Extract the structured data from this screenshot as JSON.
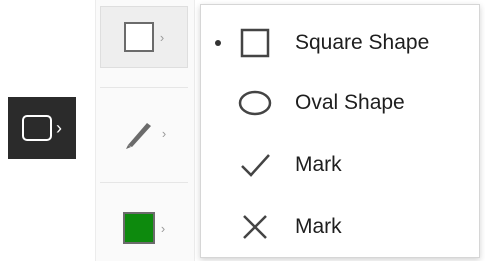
{
  "left_tool": {
    "icon": "rectangle-icon",
    "chevron": "›"
  },
  "toolbar": {
    "items": [
      {
        "name": "shape-tool-button",
        "icon": "square-icon",
        "chevron": "›",
        "selected": true
      },
      {
        "name": "pen-tool-button",
        "icon": "pen-icon",
        "chevron": "›",
        "selected": false
      },
      {
        "name": "color-tool-button",
        "icon": "color-swatch-icon",
        "chevron": "›",
        "selected": false,
        "color": "#0d8a0d"
      }
    ]
  },
  "menu": {
    "items": [
      {
        "label": "Square Shape",
        "icon": "square-shape-icon",
        "active": true
      },
      {
        "label": "Oval Shape",
        "icon": "oval-shape-icon",
        "active": false
      },
      {
        "label": "Mark",
        "icon": "check-mark-icon",
        "active": false
      },
      {
        "label": "Mark",
        "icon": "cross-mark-icon",
        "active": false
      }
    ]
  }
}
